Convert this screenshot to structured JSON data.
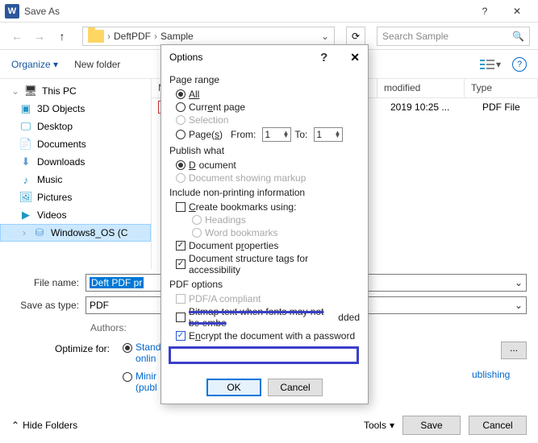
{
  "titlebar": {
    "title": "Save As"
  },
  "nav": {
    "path_crumb_1": "DeftPDF",
    "path_crumb_2": "Sample",
    "search_placeholder": "Search Sample"
  },
  "toolbar": {
    "organize": "Organize",
    "new_folder": "New folder"
  },
  "tree": {
    "this_pc": "This PC",
    "objects3d": "3D Objects",
    "desktop": "Desktop",
    "documents": "Documents",
    "downloads": "Downloads",
    "music": "Music",
    "pictures": "Pictures",
    "videos": "Videos",
    "disk": "Windows8_OS (C"
  },
  "files": {
    "header_name": "Na",
    "header_modified": "modified",
    "header_type": "Type",
    "row1_modified": "2019 10:25 ...",
    "row1_type": "PDF File"
  },
  "form": {
    "file_name_label": "File name:",
    "file_name_value": "Deft PDF pr",
    "save_type_label": "Save as type:",
    "save_type_value": "PDF",
    "authors_label": "Authors:",
    "optimize_label": "Optimize for:",
    "opt_standard_a": "Stand",
    "opt_standard_b": "onlin",
    "opt_min_a": "Minir",
    "opt_min_b": "(publ",
    "options_btn": "...",
    "after_publishing": "ublishing"
  },
  "footer": {
    "hide_folders": "Hide Folders",
    "tools": "Tools",
    "save": "Save",
    "cancel": "Cancel"
  },
  "modal": {
    "title": "Options",
    "help": "?",
    "close": "✕",
    "page_range": "Page range",
    "all": "All",
    "current_page": "Current page",
    "selection": "Selection",
    "pages": "Page(s)",
    "from": "From:",
    "from_val": "1",
    "to": "To:",
    "to_val": "1",
    "publish_what": "Publish what",
    "document": "Document",
    "doc_markup": "Document showing markup",
    "include_np": "Include non-printing information",
    "create_bookmarks": "Create bookmarks using:",
    "headings": "Headings",
    "word_bookmarks": "Word bookmarks",
    "doc_props": "Document properties",
    "doc_struct": "Document structure tags for accessibility",
    "pdf_options": "PDF options",
    "pdfa": "PDF/A compliant",
    "bitmap": "dded",
    "encrypt": "Encrypt the document with a password",
    "ok": "OK",
    "cancel": "Cancel"
  }
}
